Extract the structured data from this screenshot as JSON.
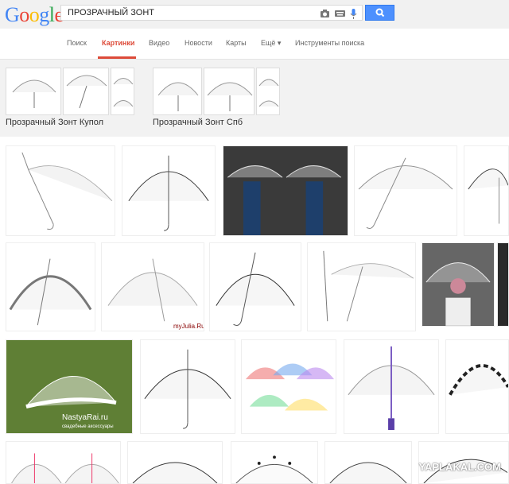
{
  "logo": {
    "text": "Google"
  },
  "search": {
    "query": "ПРОЗРАЧНЫЙ ЗОНТ"
  },
  "nav": {
    "items": [
      {
        "label": "Поиск"
      },
      {
        "label": "Картинки"
      },
      {
        "label": "Видео"
      },
      {
        "label": "Новости"
      },
      {
        "label": "Карты"
      },
      {
        "label": "Ещё ▾"
      },
      {
        "label": "Инструменты поиска"
      }
    ]
  },
  "related": [
    {
      "label": "Прозрачный Зонт Купол"
    },
    {
      "label": "Прозрачный Зонт Спб"
    }
  ],
  "captions": {
    "nastya_top": "NastyaRai.ru",
    "nastya_sub": "свадебные аксессуары",
    "myjulia": "myJulia.Ru",
    "watermark": "YAPLAKAL.COM"
  },
  "colors": {
    "accent": "#dd4b39",
    "search_button": "#4d90fe"
  }
}
